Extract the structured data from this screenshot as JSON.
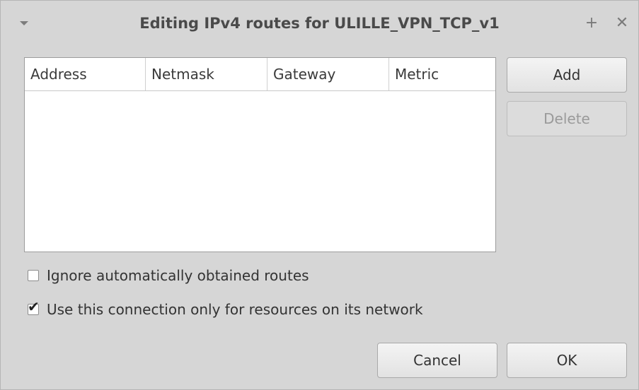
{
  "window": {
    "title": "Editing IPv4 routes for ULILLE_VPN_TCP_v1",
    "maximize_glyph": "+",
    "close_glyph": "✕"
  },
  "routes_table": {
    "columns": [
      "Address",
      "Netmask",
      "Gateway",
      "Metric"
    ],
    "rows": []
  },
  "buttons": {
    "add": "Add",
    "delete": "Delete",
    "cancel": "Cancel",
    "ok": "OK"
  },
  "options": {
    "ignore_auto_routes": {
      "label": "Ignore automatically obtained routes",
      "checked": false
    },
    "use_only_for_network": {
      "label": "Use this connection only for resources on its network",
      "checked": true
    }
  },
  "icons": {
    "window_menu": "chevron-down-icon",
    "maximize": "plus-icon",
    "close": "close-icon",
    "check": "checkmark-icon"
  },
  "colors": {
    "window_bg": "#d6d6d6",
    "table_bg": "#ffffff",
    "disabled_text": "#9a9a9a"
  }
}
